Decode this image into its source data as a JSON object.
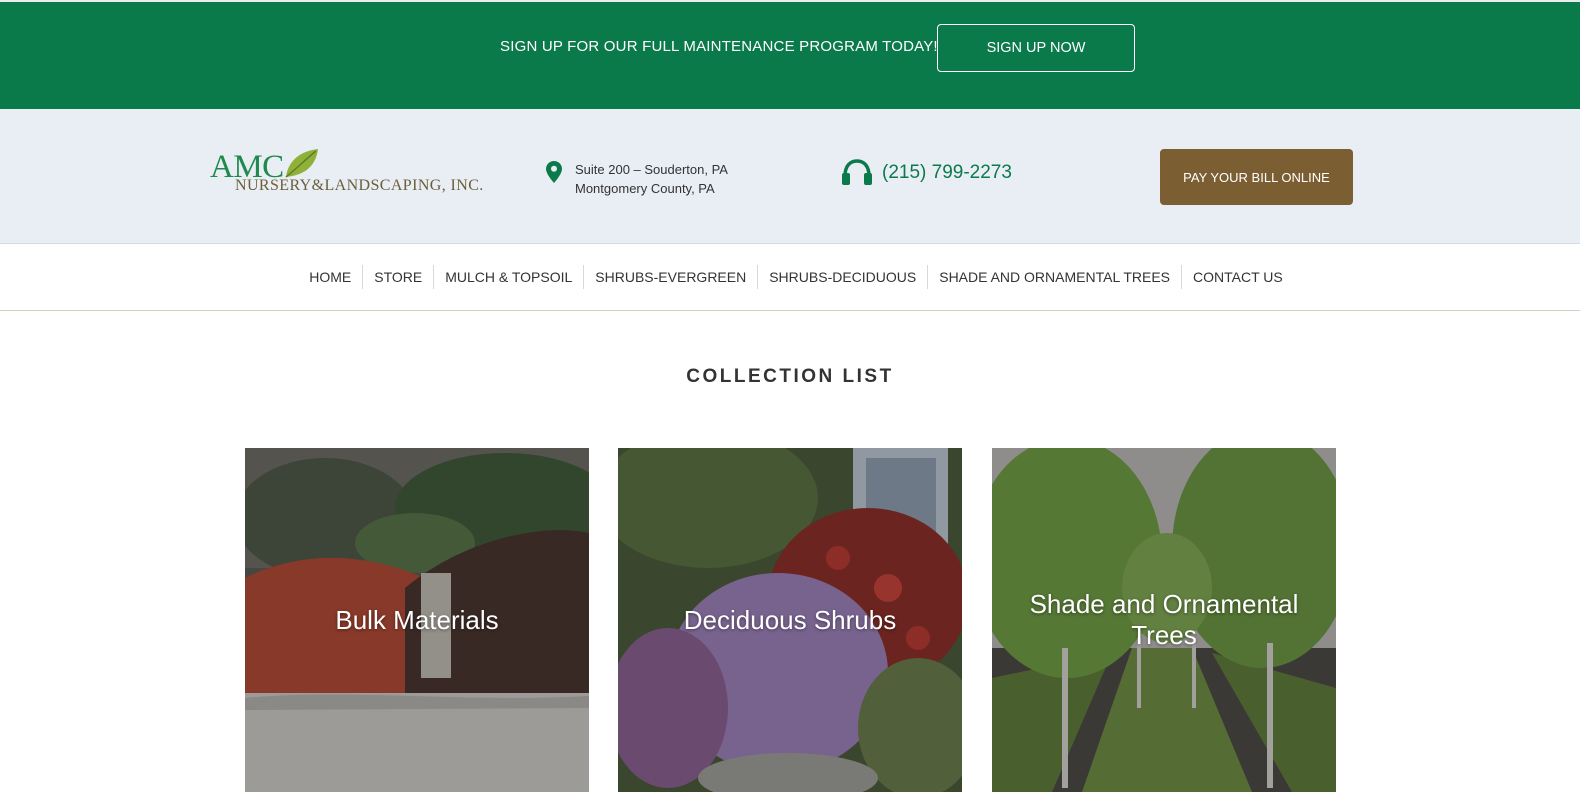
{
  "promo": {
    "text": "SIGN UP FOR OUR FULL MAINTENANCE PROGRAM TODAY!",
    "button_label": "SIGN UP NOW",
    "bg_color": "#0b7a4b"
  },
  "header": {
    "logo": {
      "line1": "AMC",
      "line2": "NURSERY&LANDSCAPING, INC."
    },
    "address": {
      "icon": "map-pin-icon",
      "line1": "Suite 200 – Souderton, PA",
      "line2": "Montgomery County, PA"
    },
    "phone": {
      "icon": "headphones-icon",
      "number": "(215) 799-2273"
    },
    "pay_button_label": "PAY YOUR BILL ONLINE",
    "pay_button_color": "#7b5f33"
  },
  "nav": {
    "items": [
      {
        "label": "HOME"
      },
      {
        "label": "STORE"
      },
      {
        "label": "MULCH & TOPSOIL"
      },
      {
        "label": "SHRUBS-EVERGREEN"
      },
      {
        "label": "SHRUBS-DECIDUOUS"
      },
      {
        "label": "SHADE AND ORNAMENTAL TREES"
      },
      {
        "label": "CONTACT US"
      }
    ]
  },
  "main": {
    "title": "COLLECTION LIST",
    "collections": [
      {
        "label": "Bulk Materials"
      },
      {
        "label": "Deciduous Shrubs"
      },
      {
        "label": "Shade and Ornamental Trees"
      }
    ]
  }
}
